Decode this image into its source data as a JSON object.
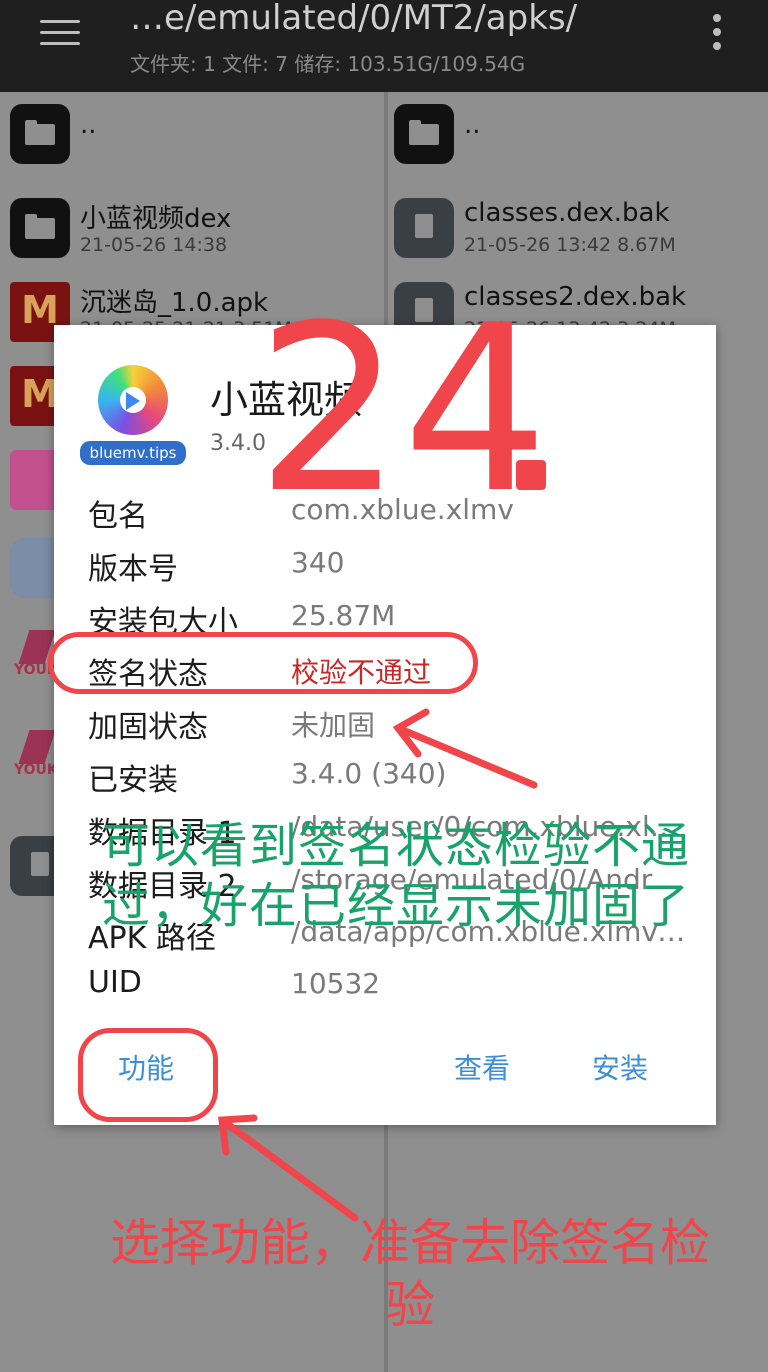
{
  "toolbar": {
    "path": "…e/emulated/0/MT2/apks/",
    "summary": "文件夹: 1  文件: 7  储存: 103.51G/109.54G"
  },
  "left_pane": {
    "items": [
      {
        "name": "..",
        "meta": ""
      },
      {
        "name": "小蓝视频dex",
        "meta": "21-05-26 14:38"
      },
      {
        "name": "沉迷岛_1.0.apk",
        "meta": "21-05-25 21:21  3.51M"
      }
    ]
  },
  "right_pane": {
    "items": [
      {
        "name": "..",
        "meta": ""
      },
      {
        "name": "classes.dex.bak",
        "meta": "21-05-26 13:42  8.67M"
      },
      {
        "name": "classes2.dex.bak",
        "meta": "21-05-26 13:42  3.24M"
      }
    ]
  },
  "dialog": {
    "logo_text": "bluemv.tips",
    "app_name": "小蓝视频",
    "app_version": "3.4.0",
    "rows": [
      {
        "label": "包名",
        "value": "com.xblue.xlmv"
      },
      {
        "label": "版本号",
        "value": "340"
      },
      {
        "label": "安装包大小",
        "value": "25.87M"
      },
      {
        "label": "签名状态",
        "value": "校验不通过"
      },
      {
        "label": "加固状态",
        "value": "未加固"
      },
      {
        "label": "已安装",
        "value": "3.4.0 (340)"
      },
      {
        "label": "数据目录 1",
        "value": "/data/user/0/com.xblue.xlmv"
      },
      {
        "label": "数据目录 2",
        "value": "/storage/emulated/0/Andro…"
      },
      {
        "label": "APK 路径",
        "value": "/data/app/com.xblue.xlmv-…"
      },
      {
        "label": "UID",
        "value": "10532"
      }
    ],
    "buttons": {
      "function": "功能",
      "view": "查看",
      "install": "安装"
    }
  },
  "annotations": {
    "step_number": "24",
    "green_note": "可以看到签名状态检验不通过，好在已经显示未加固了",
    "red_note": "选择功能，准备去除签名检验",
    "color_red": "#f0454a",
    "color_green": "#17a36a"
  }
}
